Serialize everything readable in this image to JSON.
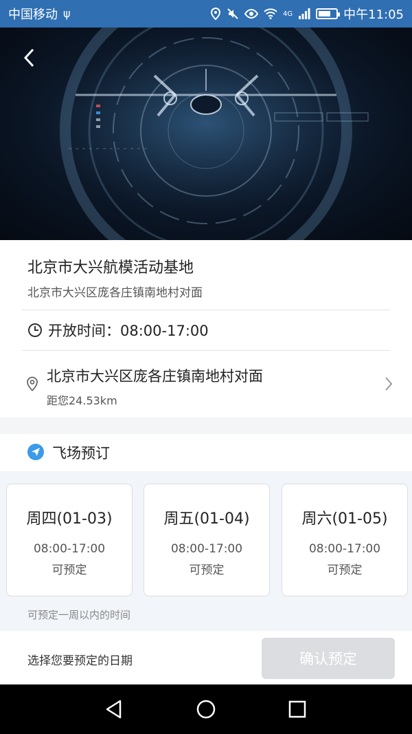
{
  "status_bar": {
    "carrier": "中国移动",
    "network": "4G",
    "time": "中午11:05"
  },
  "place": {
    "name": "北京市大兴航模活动基地",
    "subtitle": "北京市大兴区庞各庄镇南地村对面",
    "hours": "开放时间：08:00-17:00",
    "address": "北京市大兴区庞各庄镇南地村对面",
    "distance": "距您24.53km"
  },
  "booking": {
    "title": "飞场预订",
    "days": [
      {
        "label": "周四(01-03)",
        "time": "08:00-17:00",
        "status": "可预定"
      },
      {
        "label": "周五(01-04)",
        "time": "08:00-17:00",
        "status": "可预定"
      },
      {
        "label": "周六(01-05)",
        "time": "08:00-17:00",
        "status": "可预定"
      }
    ],
    "note": "可预定一周以内的时间"
  },
  "action": {
    "hint": "选择您要预定的日期",
    "confirm_label": "确认预定"
  },
  "colors": {
    "status_bar": "#2f6fb2",
    "accent": "#3b9be8",
    "disabled_button": "#dcdde0"
  }
}
